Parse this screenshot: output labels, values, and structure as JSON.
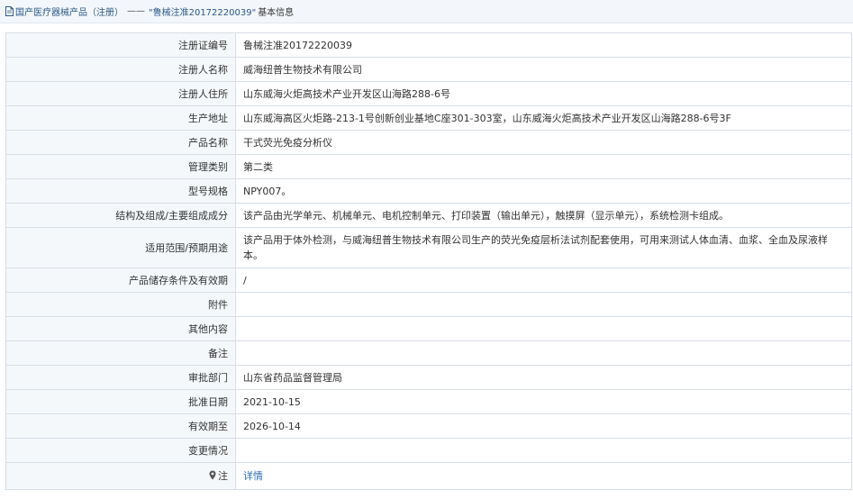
{
  "breadcrumb": {
    "icon": "document-icon",
    "category": "国产医疗器械产品（注册）",
    "separator": "——",
    "current": "\"鲁械注准20172220039\"",
    "suffix": "基本信息"
  },
  "rows": [
    {
      "label": "注册证编号",
      "value": "鲁械注准20172220039"
    },
    {
      "label": "注册人名称",
      "value": "威海纽普生物技术有限公司"
    },
    {
      "label": "注册人住所",
      "value": "山东威海火炬高技术产业开发区山海路288-6号"
    },
    {
      "label": "生产地址",
      "value": "山东威海高区火炬路-213-1号创新创业基地C座301-303室，山东威海火炬高技术产业开发区山海路288-6号3F"
    },
    {
      "label": "产品名称",
      "value": "干式荧光免疫分析仪"
    },
    {
      "label": "管理类别",
      "value": "第二类"
    },
    {
      "label": "型号规格",
      "value": "NPY007。"
    },
    {
      "label": "结构及组成/主要组成成分",
      "value": "该产品由光学单元、机械单元、电机控制单元、打印装置（输出单元），触摸屏（显示单元），系统检测卡组成。"
    },
    {
      "label": "适用范围/预期用途",
      "value": "该产品用于体外检测，与威海纽普生物技术有限公司生产的荧光免疫层析法试剂配套使用，可用来测试人体血清、血浆、全血及尿液样本。"
    },
    {
      "label": "产品储存条件及有效期",
      "value": "/"
    },
    {
      "label": "附件",
      "value": ""
    },
    {
      "label": "其他内容",
      "value": ""
    },
    {
      "label": "备注",
      "value": ""
    },
    {
      "label": "审批部门",
      "value": "山东省药品监督管理局"
    },
    {
      "label": "批准日期",
      "value": "2021-10-15"
    },
    {
      "label": "有效期至",
      "value": "2026-10-14"
    },
    {
      "label": "变更情况",
      "value": ""
    }
  ],
  "note_row": {
    "icon": "pin-icon",
    "label": "注",
    "link_text": "详情"
  },
  "colors": {
    "link": "#2b6cb0",
    "label_bg": "#f5f8fb",
    "border": "#d7dee6",
    "breadcrumb_bg": "#f3f6fa"
  }
}
